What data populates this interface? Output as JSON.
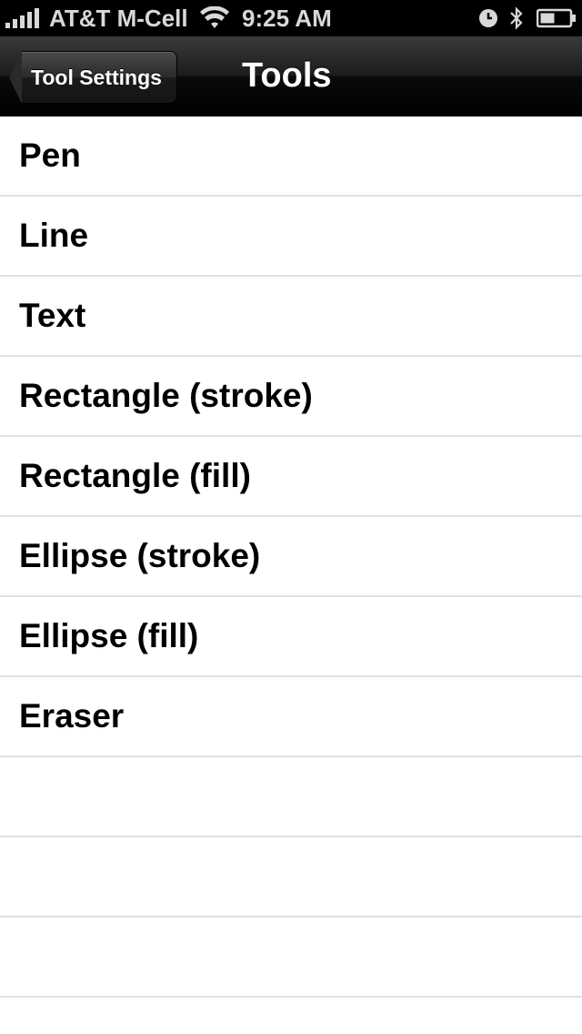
{
  "status_bar": {
    "carrier": "AT&T M-Cell",
    "time": "9:25 AM",
    "icons": [
      "signal-icon",
      "wifi-icon",
      "alarm-icon",
      "bluetooth-icon",
      "battery-icon"
    ]
  },
  "nav": {
    "back_label": "Tool Settings",
    "title": "Tools"
  },
  "tools": [
    {
      "label": "Pen"
    },
    {
      "label": "Line"
    },
    {
      "label": "Text"
    },
    {
      "label": "Rectangle (stroke)"
    },
    {
      "label": "Rectangle (fill)"
    },
    {
      "label": "Ellipse (stroke)"
    },
    {
      "label": "Ellipse (fill)"
    },
    {
      "label": "Eraser"
    }
  ],
  "colors": {
    "status_bar_bg": "#000000",
    "nav_bar_bg": "#1c1c1c",
    "row_separator": "#e0e0e0",
    "text": "#000000"
  }
}
